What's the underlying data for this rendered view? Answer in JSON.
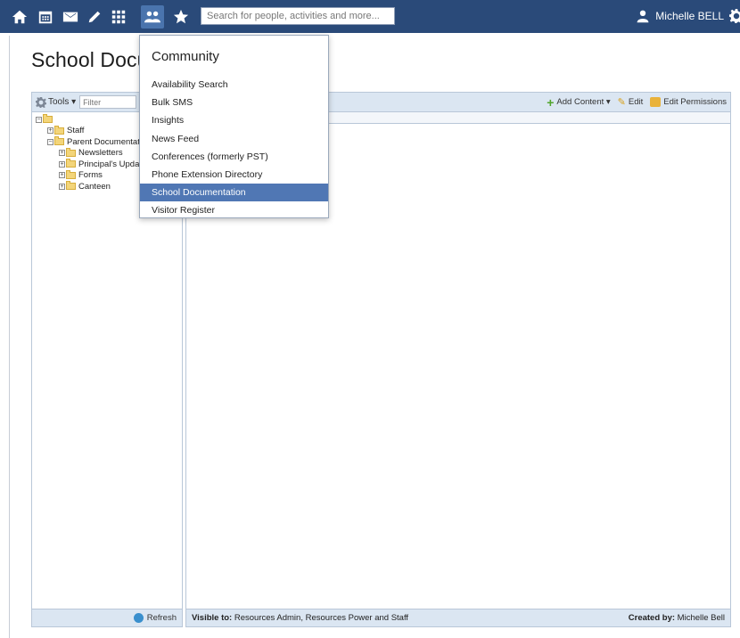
{
  "topbar": {
    "icons": [
      "home-icon",
      "calendar-icon",
      "mail-icon",
      "pencil-icon",
      "grid-icon",
      "people-icon",
      "star-icon"
    ],
    "search_placeholder": "Search for people, activities and more...",
    "user_name": "Michelle BELL"
  },
  "page": {
    "title": "School Docu"
  },
  "sidebar": {
    "tools_label": "Tools ▾",
    "filter_placeholder": "Filter",
    "tree": [
      {
        "label": "",
        "level": 0,
        "toggle": "−"
      },
      {
        "label": "Staff",
        "level": 1,
        "toggle": "+"
      },
      {
        "label": "Parent Documentat",
        "level": 1,
        "toggle": "−"
      },
      {
        "label": "Newsletters",
        "level": 2,
        "toggle": "+"
      },
      {
        "label": "Principal's Upda",
        "level": 2,
        "toggle": "+"
      },
      {
        "label": "Forms",
        "level": 2,
        "toggle": "+"
      },
      {
        "label": "Canteen",
        "level": 2,
        "toggle": "+"
      }
    ],
    "refresh_label": "Refresh"
  },
  "main": {
    "add_content_label": "Add Content ▾",
    "edit_label": "Edit",
    "edit_permissions_label": "Edit Permissions",
    "visible_to_label": "Visible to:",
    "visible_to_value": " Resources Admin, Resources Power and Staff",
    "created_by_label": "Created by:",
    "created_by_value": " Michelle Bell"
  },
  "dropdown": {
    "title": "Community",
    "items": [
      "Availability Search",
      "Bulk SMS",
      "Insights",
      "News Feed",
      "Conferences (formerly PST)",
      "Phone Extension Directory",
      "School Documentation",
      "Visitor Register"
    ],
    "selected_index": 6
  },
  "colors": {
    "topbar": "#2a4a79",
    "selected": "#5077b4",
    "panel": "#dbe6f2"
  }
}
